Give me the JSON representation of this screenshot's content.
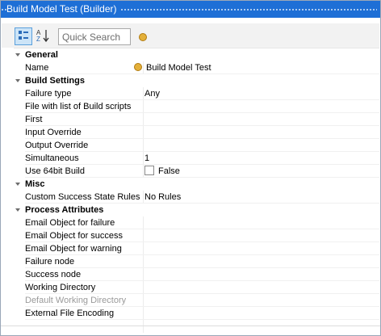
{
  "window": {
    "title": "Build Model Test (Builder)"
  },
  "toolbar": {
    "categorized_icon": "categorized-view-icon",
    "sort_icon": "alphabetical-sort-icon",
    "search_placeholder": "Quick Search",
    "status_icon": "circle-icon"
  },
  "groups": {
    "general": {
      "title": "General",
      "props": [
        {
          "name": "Name",
          "value": "Build Model Test",
          "icon": "circle-icon"
        }
      ]
    },
    "build": {
      "title": "Build Settings",
      "props": [
        {
          "name": "Failure type",
          "value": "Any"
        },
        {
          "name": "File with list of Build scripts",
          "value": ""
        },
        {
          "name": "First",
          "value": ""
        },
        {
          "name": "Input Override",
          "value": ""
        },
        {
          "name": "Output Override",
          "value": ""
        },
        {
          "name": "Simultaneous",
          "value": "1"
        },
        {
          "name": "Use 64bit Build",
          "value": "False",
          "checkbox": false
        }
      ]
    },
    "misc": {
      "title": "Misc",
      "props": [
        {
          "name": "Custom Success State Rules",
          "value": "No Rules"
        }
      ]
    },
    "process": {
      "title": "Process Attributes",
      "props": [
        {
          "name": "Email Object for failure",
          "value": ""
        },
        {
          "name": "Email Object for success",
          "value": ""
        },
        {
          "name": "Email Object for warning",
          "value": ""
        },
        {
          "name": "Failure node",
          "value": ""
        },
        {
          "name": "Success node",
          "value": ""
        },
        {
          "name": "Working Directory",
          "value": ""
        },
        {
          "name": "Default Working Directory",
          "value": "",
          "disabled": true
        },
        {
          "name": "External File Encoding",
          "value": ""
        }
      ]
    }
  }
}
